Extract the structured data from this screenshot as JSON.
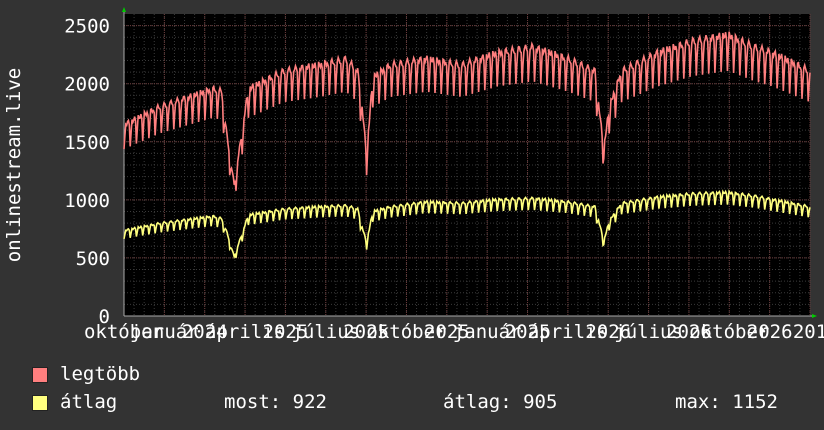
{
  "chart_data": {
    "type": "line",
    "ylabel": "onlinestream.live",
    "ylim": [
      0,
      2600
    ],
    "yticks": [
      0,
      500,
      1000,
      1500,
      2000,
      2500
    ],
    "xticks": [
      "október",
      "január",
      "2024",
      "április",
      "2025",
      "július",
      "2025",
      "október",
      "2025",
      "január",
      "2025",
      "április",
      "2026",
      "július",
      "2026",
      "október",
      "2026",
      "201"
    ],
    "grid": true,
    "colors": {
      "background": "#333333",
      "plot": "#000000",
      "grid": "#444444",
      "axis": "#aaaaaa",
      "legtobb": "#ff7f7f",
      "atlag": "#ffff7f"
    },
    "series": [
      {
        "name": "legtöbb",
        "color": "#ff7f7f",
        "x": [
          0,
          40,
          80,
          100,
          110,
          116,
          124,
          140,
          180,
          220,
          250,
          263,
          268,
          273,
          280,
          300,
          340,
          380,
          420,
          460,
          500,
          530,
          536,
          540,
          546,
          560,
          600,
          640,
          680,
          710,
          730,
          772
        ],
        "values": [
          1600,
          1750,
          1850,
          1900,
          1880,
          1500,
          1100,
          1900,
          2050,
          2100,
          2150,
          2050,
          1750,
          1350,
          2000,
          2100,
          2150,
          2100,
          2200,
          2250,
          2150,
          2050,
          1650,
          1400,
          1750,
          2050,
          2200,
          2300,
          2350,
          2250,
          2200,
          2050
        ]
      },
      {
        "name": "átlag",
        "color": "#ffff7f",
        "x": [
          0,
          40,
          80,
          100,
          110,
          116,
          124,
          140,
          180,
          220,
          250,
          263,
          268,
          273,
          280,
          300,
          340,
          380,
          420,
          460,
          500,
          530,
          536,
          540,
          546,
          560,
          600,
          640,
          680,
          710,
          730,
          772
        ],
        "values": [
          720,
          780,
          820,
          840,
          820,
          700,
          500,
          850,
          900,
          920,
          930,
          900,
          750,
          620,
          880,
          920,
          960,
          950,
          980,
          990,
          960,
          920,
          750,
          630,
          800,
          950,
          1000,
          1030,
          1040,
          1010,
          980,
          920
        ]
      }
    ]
  },
  "legend": [
    {
      "label": "legtöbb",
      "color": "#ff7f7f"
    },
    {
      "label": "átlag",
      "color": "#ffff7f"
    }
  ],
  "stats": {
    "now": "most: 922",
    "avg": "átlag: 905",
    "max": "max: 1152"
  }
}
